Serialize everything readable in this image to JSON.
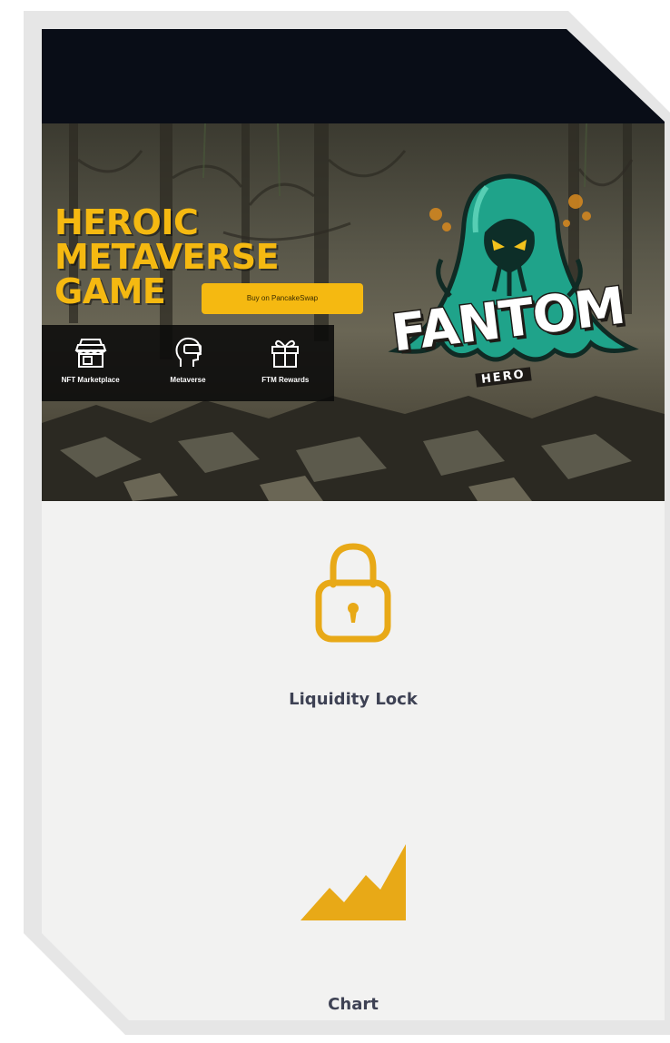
{
  "banner": {
    "headline": [
      "HEROIC",
      "METAVERSE",
      "GAME"
    ],
    "buy_button": "Buy on PancakeSwap",
    "features": [
      {
        "label": "NFT Marketplace",
        "icon": "store-icon"
      },
      {
        "label": "Metaverse",
        "icon": "vr-headset-icon"
      },
      {
        "label": "FTM Rewards",
        "icon": "gift-icon"
      }
    ],
    "logo": {
      "title": "FANTOM",
      "subtitle": "HERO"
    }
  },
  "tiles": [
    {
      "label": "Liquidity Lock",
      "icon": "lock-icon"
    },
    {
      "label": "Chart",
      "icon": "chart-icon"
    }
  ],
  "colors": {
    "accent": "#E8A917",
    "dark_bar": "#090D17",
    "card_bg": "#F2F2F1",
    "text": "#3E4254",
    "ghost": "#1FA38A"
  }
}
